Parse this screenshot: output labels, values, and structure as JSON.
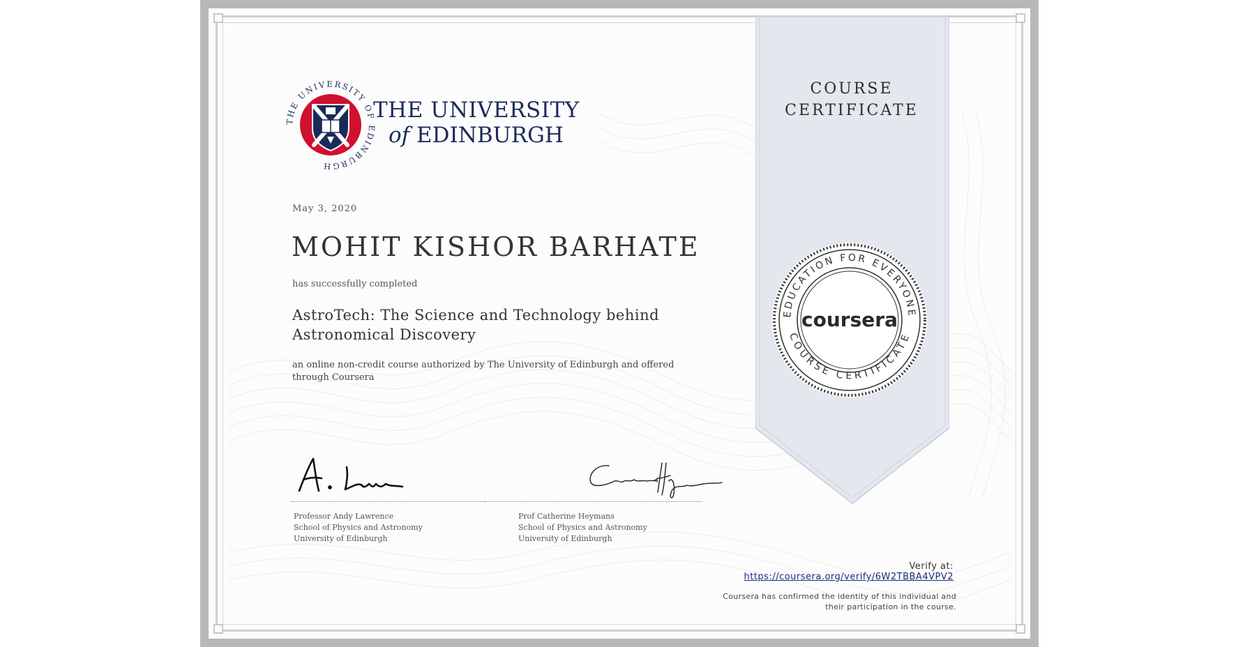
{
  "university": {
    "line1": "THE UNIVERSITY",
    "line2_prefix": "of",
    "line2_main": "EDINBURGH",
    "seal_ring_text": "THE UNIVERSITY OF EDINBURGH"
  },
  "ribbon": {
    "line1": "COURSE",
    "line2": "CERTIFICATE"
  },
  "seal": {
    "brand": "coursera",
    "ring_top": "EDUCATION FOR EVERYONE",
    "ring_bottom": "COURSE CERTIFICATE"
  },
  "certificate": {
    "date": "May 3, 2020",
    "recipient": "MOHIT KISHOR BARHATE",
    "completed_text": "has successfully completed",
    "course_title": "AstroTech: The Science and Technology behind Astronomical Discovery",
    "description": "an online non-credit course authorized by The University of Edinburgh and offered through Coursera"
  },
  "signers": [
    {
      "name": "Professor Andy Lawrence",
      "dept": "School of Physics and Astronomy",
      "org": "University of Edinburgh"
    },
    {
      "name": "Prof Catherine Heymans",
      "dept": "School of Physics and Astronomy",
      "org": "University of Edinburgh"
    }
  ],
  "verify": {
    "label": "Verify at:",
    "url": "https://coursera.org/verify/6W2TBBA4VPV2",
    "note": "Coursera has confirmed the identity of this individual and their participation in the course."
  },
  "colors": {
    "ribbon": "#e3e7ee",
    "university_navy": "#1a2b5a",
    "university_red": "#d0102f",
    "link": "#1a2b7a"
  }
}
